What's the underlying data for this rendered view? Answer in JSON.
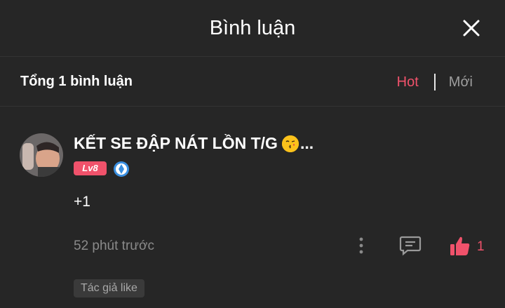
{
  "header": {
    "title": "Bình luận",
    "close_icon": "close-icon"
  },
  "subheader": {
    "total_label": "Tổng 1 bình luận",
    "sort_tabs": [
      {
        "label": "Hot",
        "active": true,
        "color": "#f0526b"
      },
      {
        "label": "Mới",
        "active": false,
        "color": "#9e9e9e"
      }
    ]
  },
  "comment": {
    "username_prefix": "KẾT SE ĐẬP NÁT LỒN T/G",
    "username_suffix": "...",
    "emoji": "kissing-face-emoji",
    "level": "Lv8",
    "badge_icon": "verified-badge-icon",
    "text": "+1",
    "time": "52 phút trước",
    "like_count": "1",
    "author_tag": "Tác giả like"
  },
  "colors": {
    "background": "#262626",
    "accent": "#f0526b",
    "muted_text": "#8a8a8a"
  }
}
